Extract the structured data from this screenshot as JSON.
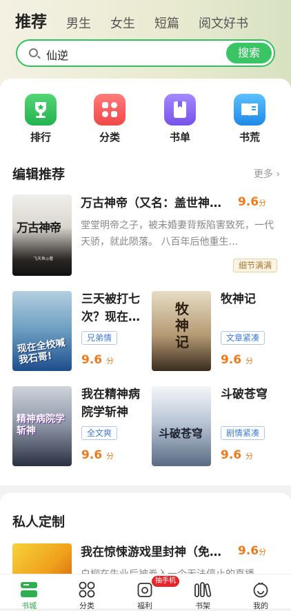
{
  "header": {
    "tabs": [
      {
        "label": "推荐",
        "active": true
      },
      {
        "label": "男生"
      },
      {
        "label": "女生"
      },
      {
        "label": "短篇"
      },
      {
        "label": "阅文好书"
      }
    ]
  },
  "search": {
    "value": "仙逆",
    "button": "搜索"
  },
  "shortcuts": [
    {
      "label": "排行",
      "icon": "trophy-icon",
      "color": "#2ec25a"
    },
    {
      "label": "分类",
      "icon": "category-grid-icon",
      "color": "#fb5b5b"
    },
    {
      "label": "书单",
      "icon": "booklist-icon",
      "color": "#8a6cf2"
    },
    {
      "label": "书荒",
      "icon": "open-book-icon",
      "color": "#2f9cf0"
    }
  ],
  "editor_picks": {
    "title": "编辑推荐",
    "more": "更多",
    "featured": {
      "title": "万古神帝（又名：盖世神…",
      "score": "9.6",
      "score_unit": "分",
      "desc": "堂堂明帝之子，被未婚妻背叛陷害致死，一代天骄，就此陨落。 八百年后他重生…",
      "tag": "细节满满",
      "cover_text": "万古神帝",
      "cover_author": "飞天鱼◎著"
    },
    "books": [
      {
        "title": "三天被打七次？现在…",
        "tag": "兄弟情",
        "score": "9.6",
        "score_unit": "分",
        "cover_text": "现在全校喊我石哥!"
      },
      {
        "title": "牧神记",
        "tag": "文章紧凑",
        "score": "9.6",
        "score_unit": "分",
        "cover_text": "牧神记"
      },
      {
        "title": "我在精神病院学斩神",
        "tag": "全文爽",
        "score": "9.6",
        "score_unit": "分",
        "cover_text": "精神病院学斩神"
      },
      {
        "title": "斗破苍穹",
        "tag": "剧情紧凑",
        "score": "9.6",
        "score_unit": "分",
        "cover_text": "斗破苍穹"
      }
    ]
  },
  "custom": {
    "title": "私人定制",
    "book": {
      "title": "我在惊悚游戏里封神（免…",
      "score": "9.6",
      "score_unit": "分",
      "desc": "白柳在失业后被卷入一个无法停止的直播"
    }
  },
  "nav": {
    "items": [
      {
        "label": "书城",
        "icon": "bookstore-icon",
        "active": true
      },
      {
        "label": "分类",
        "icon": "grid-icon"
      },
      {
        "label": "福利",
        "icon": "gift-icon"
      },
      {
        "label": "书架",
        "icon": "bookshelf-icon"
      },
      {
        "label": "我的",
        "icon": "profile-icon"
      }
    ],
    "badge": "抽手机"
  }
}
